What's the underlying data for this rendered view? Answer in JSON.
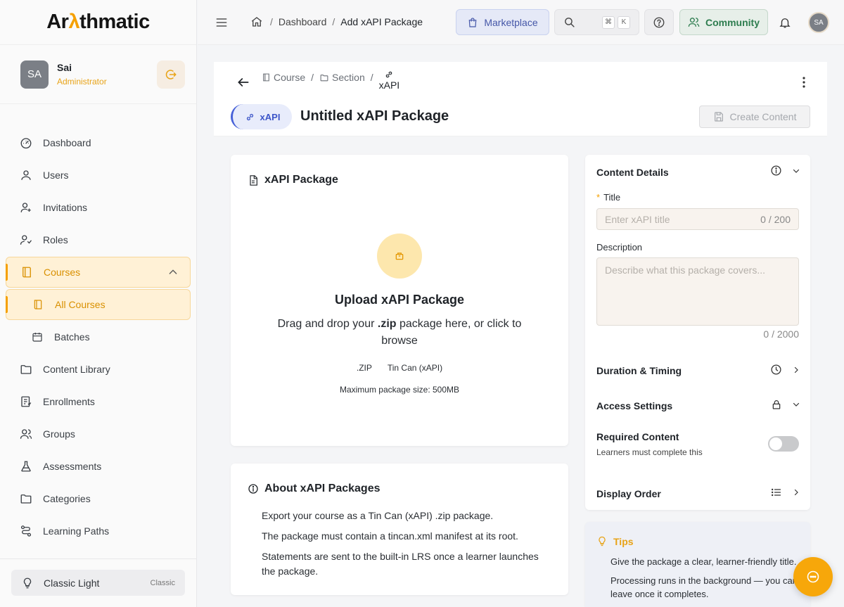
{
  "app": {
    "logo_prefix": "Ar",
    "logo_accent": "λ",
    "logo_suffix": "thmatic"
  },
  "profile": {
    "initials": "SA",
    "name": "Sai",
    "role": "Administrator"
  },
  "sidebar": {
    "items": [
      {
        "label": "Dashboard",
        "icon": "gauge-icon"
      },
      {
        "label": "Users",
        "icon": "user-icon"
      },
      {
        "label": "Invitations",
        "icon": "user-plus-icon"
      },
      {
        "label": "Roles",
        "icon": "roles-icon"
      },
      {
        "label": "Courses",
        "icon": "book-icon"
      },
      {
        "label": "All Courses",
        "icon": "book-icon"
      },
      {
        "label": "Batches",
        "icon": "calendar-icon"
      },
      {
        "label": "Content Library",
        "icon": "folder-icon"
      },
      {
        "label": "Enrollments",
        "icon": "clipboard-icon"
      },
      {
        "label": "Groups",
        "icon": "users-icon"
      },
      {
        "label": "Assessments",
        "icon": "flask-icon"
      },
      {
        "label": "Categories",
        "icon": "folder-icon"
      },
      {
        "label": "Learning Paths",
        "icon": "route-icon"
      }
    ],
    "theme": {
      "label": "Classic Light",
      "tag": "Classic"
    }
  },
  "topbar": {
    "breadcrumb": [
      "Dashboard",
      "Add xAPI Package"
    ],
    "marketplace_label": "Marketplace",
    "shortcut_keys": [
      "⌘",
      "K"
    ],
    "community_label": "Community",
    "avatar_initials": "SA"
  },
  "page": {
    "breadcrumb": {
      "course": "Course",
      "section": "Section",
      "current": "xAPI"
    },
    "type_badge": "xAPI",
    "title": "Untitled xAPI Package",
    "create_label": "Create Content"
  },
  "upload": {
    "card_title": "xAPI Package",
    "title": "Upload xAPI Package",
    "desc_before": "Drag and drop your ",
    "desc_bold": ".zip",
    "desc_after": " package here, or click to browse",
    "formats": [
      ".ZIP",
      "Tin Can (xAPI)"
    ],
    "max_size": "Maximum package size: 500MB"
  },
  "about": {
    "title": "About xAPI Packages",
    "items": [
      "Export your course as a Tin Can (xAPI) .zip package.",
      "The package must contain a tincan.xml manifest at its root.",
      "Statements are sent to the built-in LRS once a learner launches the package."
    ]
  },
  "details": {
    "section_title": "Content Details",
    "title_label": "Title",
    "title_required": "*",
    "title_placeholder": "Enter xAPI title",
    "title_count": "0 / 200",
    "description_label": "Description",
    "description_placeholder": "Describe what this package covers...",
    "description_count": "0 / 2000",
    "duration_title": "Duration & Timing",
    "access_title": "Access Settings",
    "required_title": "Required Content",
    "required_sub": "Learners must complete this",
    "required_on": false,
    "order_title": "Display Order"
  },
  "tips": {
    "title": "Tips",
    "items": [
      "Give the package a clear, learner-friendly title.",
      "Processing runs in the background — you can leave once it completes."
    ]
  },
  "colors": {
    "accent": "#f5a000",
    "primary_blue": "#4660d8",
    "community_green": "#2e7d4f"
  }
}
